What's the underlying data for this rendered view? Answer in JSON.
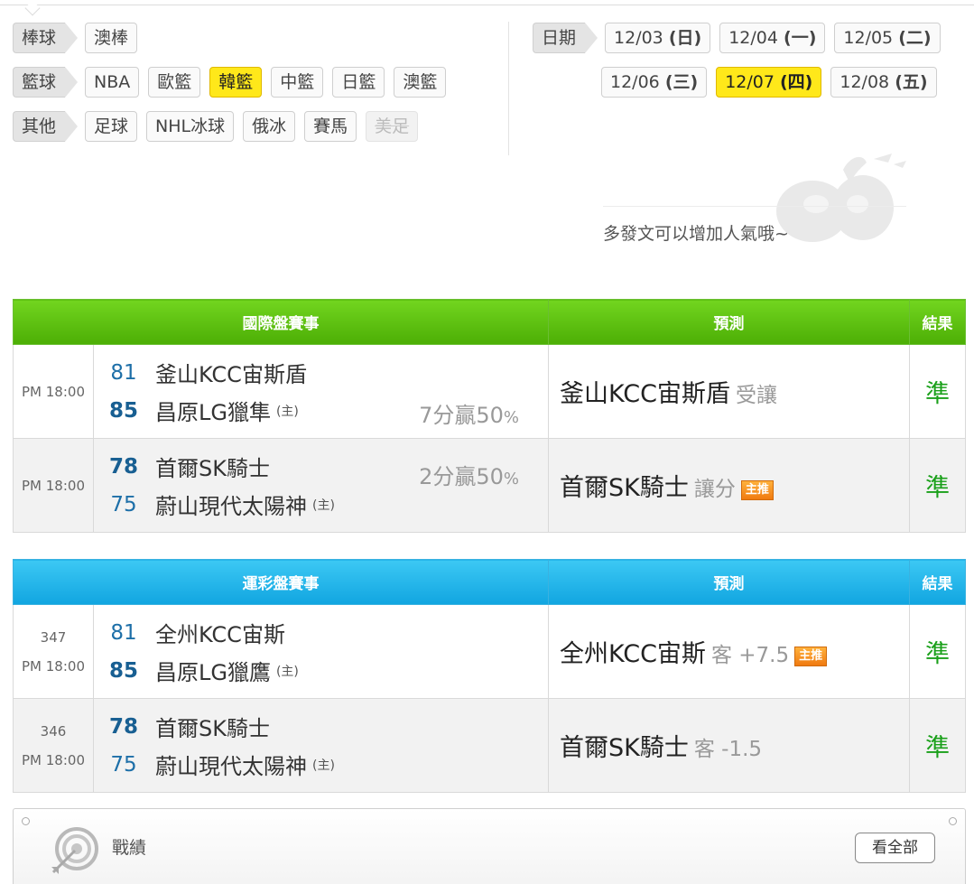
{
  "filters": {
    "baseball": {
      "label": "棒球",
      "items": [
        {
          "label": "澳棒",
          "state": "normal"
        }
      ]
    },
    "basketball": {
      "label": "籃球",
      "items": [
        {
          "label": "NBA",
          "state": "normal"
        },
        {
          "label": "歐籃",
          "state": "normal"
        },
        {
          "label": "韓籃",
          "state": "active"
        },
        {
          "label": "中籃",
          "state": "normal"
        },
        {
          "label": "日籃",
          "state": "normal"
        },
        {
          "label": "澳籃",
          "state": "normal"
        }
      ]
    },
    "other": {
      "label": "其他",
      "items": [
        {
          "label": "足球",
          "state": "normal"
        },
        {
          "label": "NHL冰球",
          "state": "normal"
        },
        {
          "label": "俄冰",
          "state": "normal"
        },
        {
          "label": "賽馬",
          "state": "normal"
        },
        {
          "label": "美足",
          "state": "disabled"
        }
      ]
    }
  },
  "dates": {
    "label": "日期",
    "row1": [
      {
        "date": "12/03",
        "dow": "(日)",
        "state": "normal"
      },
      {
        "date": "12/04",
        "dow": "(一)",
        "state": "normal"
      },
      {
        "date": "12/05",
        "dow": "(二)",
        "state": "normal"
      }
    ],
    "row2": [
      {
        "date": "12/06",
        "dow": "(三)",
        "state": "normal"
      },
      {
        "date": "12/07",
        "dow": "(四)",
        "state": "active"
      },
      {
        "date": "12/08",
        "dow": "(五)",
        "state": "normal"
      }
    ]
  },
  "promo": {
    "text": "多發文可以增加人氣哦~"
  },
  "intl": {
    "headers": {
      "event": "國際盤賽事",
      "predict": "預測",
      "result": "結果"
    },
    "rows": [
      {
        "time": "PM 18:00",
        "away": {
          "score": "81",
          "name": "釜山KCC宙斯盾",
          "win": false
        },
        "home": {
          "score": "85",
          "name": "昌原LG獵隼",
          "win": true,
          "mark": "(主)"
        },
        "odds_value": "7分贏50",
        "odds_pct": "%",
        "odds_row": "bottom",
        "pred_team": "釜山KCC宙斯盾",
        "pred_type": "受讓",
        "badge": "",
        "result": "準"
      },
      {
        "time": "PM 18:00",
        "away": {
          "score": "78",
          "name": "首爾SK騎士",
          "win": true
        },
        "home": {
          "score": "75",
          "name": "蔚山現代太陽神",
          "win": false,
          "mark": "(主)"
        },
        "odds_value": "2分贏50",
        "odds_pct": "%",
        "odds_row": "top",
        "pred_team": "首爾SK騎士",
        "pred_type": "讓分",
        "badge": "主推",
        "result": "準"
      }
    ]
  },
  "lottery": {
    "headers": {
      "event": "運彩盤賽事",
      "predict": "預測",
      "result": "結果"
    },
    "rows": [
      {
        "no": "347",
        "time": "PM 18:00",
        "away": {
          "score": "81",
          "name": "全州KCC宙斯",
          "win": false
        },
        "home": {
          "score": "85",
          "name": "昌原LG獵鷹",
          "win": true,
          "mark": "(主)"
        },
        "pred_team": "全州KCC宙斯",
        "pred_type": "客 +7.5",
        "badge": "主推",
        "result": "準"
      },
      {
        "no": "346",
        "time": "PM 18:00",
        "away": {
          "score": "78",
          "name": "首爾SK騎士",
          "win": true
        },
        "home": {
          "score": "75",
          "name": "蔚山現代太陽神",
          "win": false,
          "mark": "(主)"
        },
        "pred_team": "首爾SK騎士",
        "pred_type": "客 -1.5",
        "badge": "",
        "result": "準"
      }
    ]
  },
  "record": {
    "title": "戰績",
    "see_all": "看全部"
  },
  "colors": {
    "active_chip": "#ffe81a",
    "green_header": "#4cae05",
    "blue_header": "#11a5e0",
    "win_result": "#1aa01a",
    "score_blue": "#1d6fa8"
  },
  "icons": {
    "record": "target-icon",
    "promo": "decorative-figure"
  }
}
